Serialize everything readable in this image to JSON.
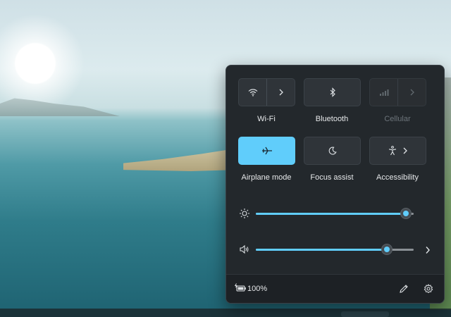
{
  "quick_settings": {
    "tiles": [
      {
        "label": "Wi-Fi",
        "icon": "wifi-icon",
        "state": "off",
        "has_chevron": true
      },
      {
        "label": "Bluetooth",
        "icon": "bluetooth-icon",
        "state": "off",
        "has_chevron": false
      },
      {
        "label": "Cellular",
        "icon": "cellular-icon",
        "state": "disabled",
        "has_chevron": true
      },
      {
        "label": "Airplane mode",
        "icon": "airplane-icon",
        "state": "on",
        "has_chevron": false
      },
      {
        "label": "Focus assist",
        "icon": "moon-icon",
        "state": "off",
        "has_chevron": false
      },
      {
        "label": "Accessibility",
        "icon": "accessibility-icon",
        "state": "off",
        "has_chevron": true
      }
    ],
    "brightness": {
      "icon": "brightness-icon",
      "level": 0.95
    },
    "volume": {
      "icon": "speaker-icon",
      "level": 0.83,
      "has_chevron": true
    },
    "footer": {
      "battery_icon": "battery-charging-icon",
      "battery_percent": "100%",
      "edit_icon": "pencil-icon",
      "settings_icon": "gear-icon"
    },
    "colors": {
      "accent": "#60cdfb",
      "panel_bg": "#23282c",
      "tile_bg": "#2f3439"
    }
  }
}
